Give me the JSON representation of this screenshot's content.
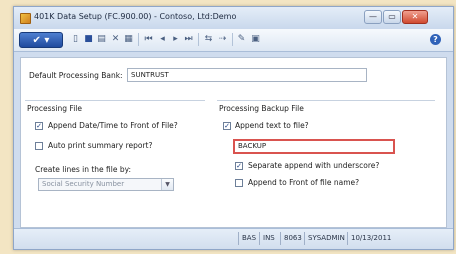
{
  "window": {
    "title": "401K Data Setup (FC.900.00) - Contoso, Ltd:Demo",
    "buttons": {
      "minimize": "—",
      "maximize": "▭",
      "close": "✕"
    }
  },
  "toolbar": {
    "menu_label": "✔",
    "icons": [
      "new-document-icon",
      "save-icon",
      "copy-icon",
      "delete-icon",
      "grid-icon",
      "first-record-icon",
      "previous-record-icon",
      "next-record-icon",
      "last-record-icon",
      "import-icon",
      "export-icon",
      "notes-icon",
      "attach-icon"
    ],
    "help": "?"
  },
  "form": {
    "default_bank_label": "Default Processing Bank:",
    "default_bank_value": "SUNTRUST",
    "processing_file": {
      "title": "Processing File",
      "append_datetime_label": "Append Date/Time to Front of File?",
      "append_datetime_checked": "✓",
      "auto_print_label": "Auto print summary report?",
      "create_lines_label": "Create lines in the file by:",
      "create_lines_value": "Social Security Number"
    },
    "backup_file": {
      "title": "Processing Backup File",
      "append_text_label": "Append text to file?",
      "append_text_checked": "✓",
      "backup_text_value": "BACKUP",
      "separate_underscore_label": "Separate append with underscore?",
      "separate_underscore_checked": "✓",
      "append_front_label": "Append to Front of file name?"
    }
  },
  "status": {
    "cells": [
      "BAS",
      "INS",
      "8063",
      "SYSADMIN",
      "10/13/2011"
    ]
  },
  "colors": {
    "highlight_border": "#d9534f",
    "menu_blue": "#2f5fb8",
    "background": "#f3e5c3"
  }
}
